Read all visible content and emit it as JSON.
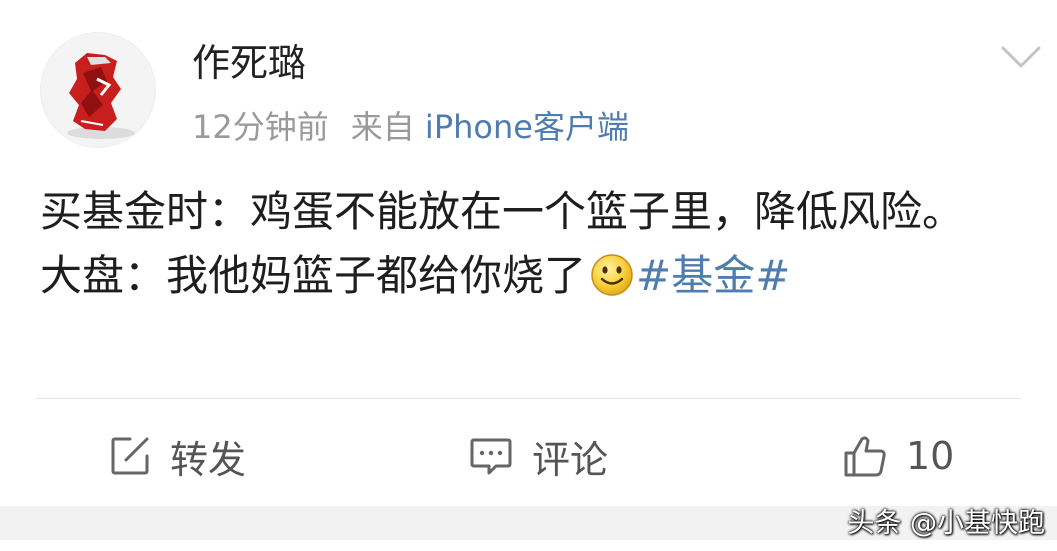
{
  "post": {
    "author": {
      "name": "作死璐"
    },
    "time": "12分钟前",
    "source_prefix": "来自",
    "source_client": "iPhone客户端",
    "content": {
      "line1": "买基金时：鸡蛋不能放在一个篮子里，降低风险。",
      "line2_text": "大盘：我他妈篮子都给你烧了",
      "emoji": "smiley",
      "topic": "#基金#"
    }
  },
  "actions": {
    "repost_label": "转发",
    "comment_label": "评论",
    "like_count": "10"
  },
  "watermark": "头条 @小基快跑",
  "colors": {
    "link": "#507daf",
    "meta": "#9a9a9a",
    "text": "#1e1e1e",
    "avatar_can": "#c81e1e"
  },
  "icons": {
    "repost": "edit-square-icon",
    "comment": "comment-bubble-icon",
    "like": "thumbs-up-icon",
    "more": "chevron-down-icon"
  }
}
